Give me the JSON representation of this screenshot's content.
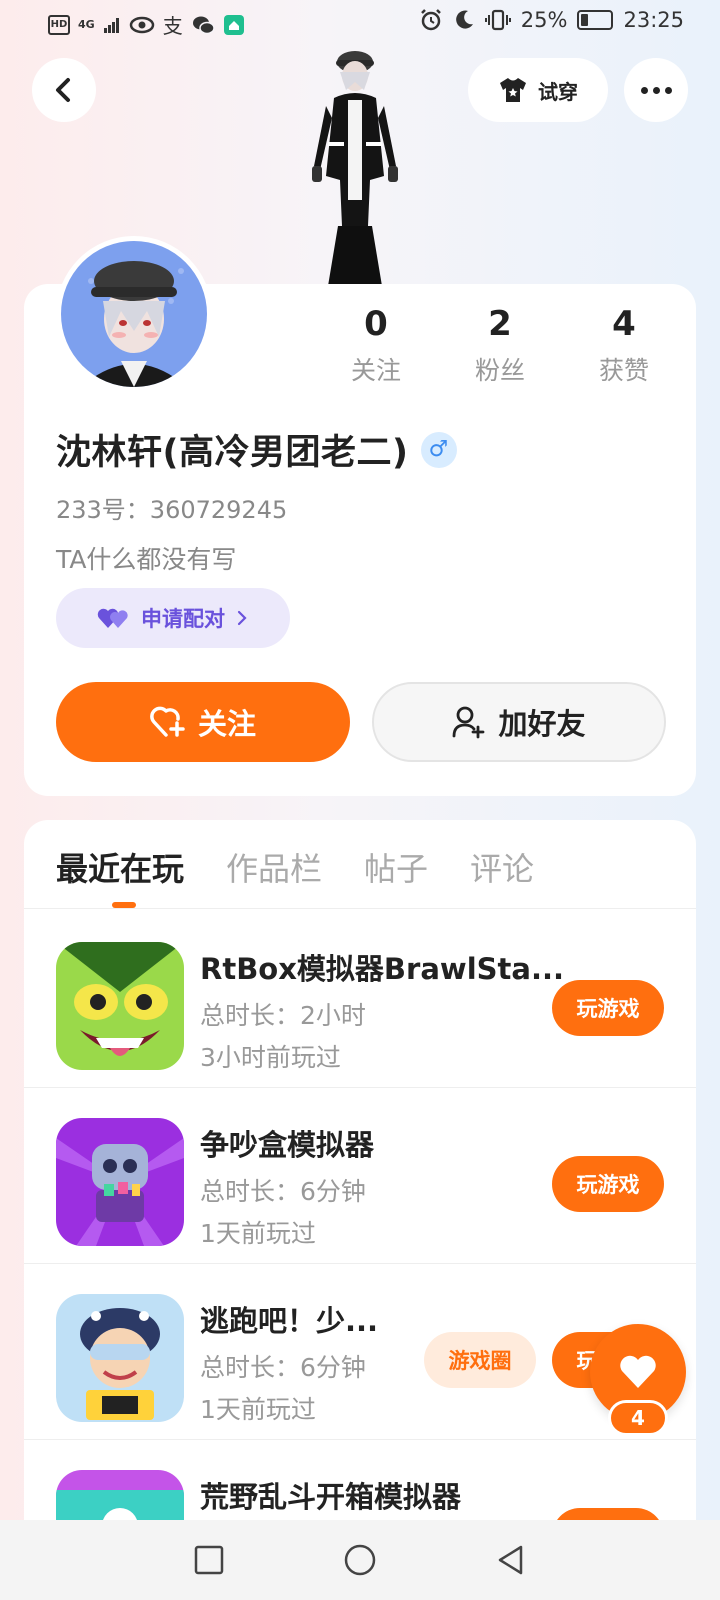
{
  "status_bar": {
    "hd": "HD",
    "network": "4G",
    "alipay": "支",
    "battery": "25%",
    "time": "23:25"
  },
  "header": {
    "back_icon": "chevron-left-icon",
    "try_on_label": "试穿",
    "more_icon": "more-dots-icon"
  },
  "profile": {
    "stats": [
      {
        "value": "0",
        "label": "关注"
      },
      {
        "value": "2",
        "label": "粉丝"
      },
      {
        "value": "4",
        "label": "获赞"
      }
    ],
    "name": "沈林轩(高冷男团老二)",
    "gender_symbol": "♂",
    "uid_text": "233号：360729245",
    "bio": "TA什么都没有写",
    "pair_label": "申请配对",
    "follow_label": "关注",
    "add_friend_label": "加好友"
  },
  "tabs": [
    {
      "label": "最近在玩",
      "active": true
    },
    {
      "label": "作品栏",
      "active": false
    },
    {
      "label": "帖子",
      "active": false
    },
    {
      "label": "评论",
      "active": false
    }
  ],
  "games": [
    {
      "title": "RtBox模拟器BrawlSta...",
      "duration": "总时长：2小时",
      "last_played": "3小时前玩过",
      "play_label": "玩游戏"
    },
    {
      "title": "争吵盒模拟器",
      "duration": "总时长：6分钟",
      "last_played": "1天前玩过",
      "play_label": "玩游戏"
    },
    {
      "title": "逃跑吧！少...",
      "duration": "总时长：6分钟",
      "last_played": "1天前玩过",
      "circle_label": "游戏圈",
      "play_label": "玩游戏"
    },
    {
      "title": "荒野乱斗开箱模拟器",
      "duration": "",
      "last_played": "",
      "play_label": ""
    }
  ],
  "like_fab": {
    "count": "4"
  },
  "colors": {
    "accent": "#ff6f0f",
    "purple": "#6a52dc",
    "gender_blue": "#3b8cf0"
  }
}
